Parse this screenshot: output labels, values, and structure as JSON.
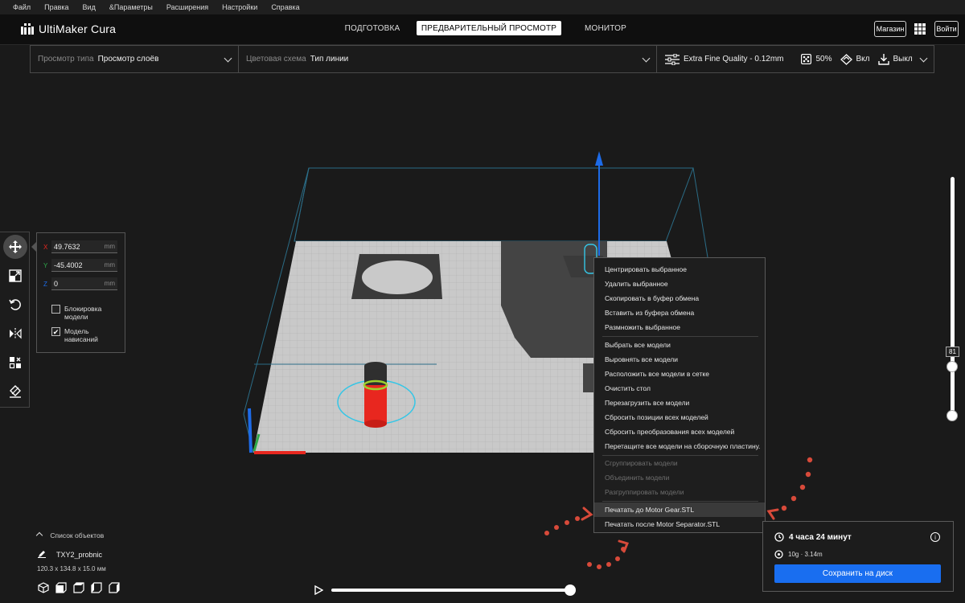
{
  "menubar": [
    "Файл",
    "Правка",
    "Вид",
    "&Параметры",
    "Расширения",
    "Настройки",
    "Справка"
  ],
  "header": {
    "logo": "UltiMaker Cura",
    "tabs": [
      "ПОДГОТОВКА",
      "ПРЕДВАРИТЕЛЬНЫЙ ПРОСМОТР",
      "МОНИТОР"
    ],
    "active_tab": "ПРЕДВАРИТЕЛЬНЫЙ ПРОСМОТР",
    "marketplace": "Магазин",
    "signin": "Войти"
  },
  "toolbar": {
    "view_type_label": "Просмотр типа",
    "view_type_value": "Просмотр слоёв",
    "color_scheme_label": "Цветовая схема",
    "color_scheme_value": "Тип линии",
    "profile": "Extra Fine Quality - 0.12mm",
    "infill": "50%",
    "support": "Вкл",
    "adhesion": "Выкл"
  },
  "move_panel": {
    "x_axis": "X",
    "y_axis": "Y",
    "z_axis": "Z",
    "x": "49.7632",
    "y": "-45.4002",
    "z": "0",
    "unit": "mm",
    "lock_model": "Блокировка модели",
    "drop_model": "Модель нависаний",
    "drop_checked": "✔"
  },
  "context_menu": {
    "group1": [
      "Центрировать выбранное",
      "Удалить выбранное",
      "Скопировать в буфер обмена",
      "Вставить из буфера обмена",
      "Размножить выбранное"
    ],
    "group2": [
      "Выбрать все модели",
      "Выровнять все модели",
      "Расположить все модели в сетке",
      "Очистить стол",
      "Перезагрузить все модели",
      "Сбросить позиции всех моделей",
      "Сбросить преобразования всех моделей",
      "Перетащите все модели на сборочную пластину."
    ],
    "group3": [
      "Сгруппировать модели",
      "Объединить модели",
      "Разгруппировать модели"
    ],
    "group4": [
      "Печатать до Motor Gear.STL",
      "Печатать после Motor Separator.STL"
    ]
  },
  "layer_slider": {
    "current_layer": "81"
  },
  "objects": {
    "list_label": "Список объектов",
    "name": "TXY2_probnic",
    "dims": "120.3 x 134.8 x 15.0 мм"
  },
  "print_panel": {
    "time": "4 часа 24 минут",
    "material": "10g · 3.14m",
    "save": "Сохранить на диск",
    "info": "i"
  },
  "colors": {
    "accent": "#196ef0",
    "annotation": "#d84a3a",
    "model_red": "#e8271f",
    "cyan": "#35c6e6"
  }
}
